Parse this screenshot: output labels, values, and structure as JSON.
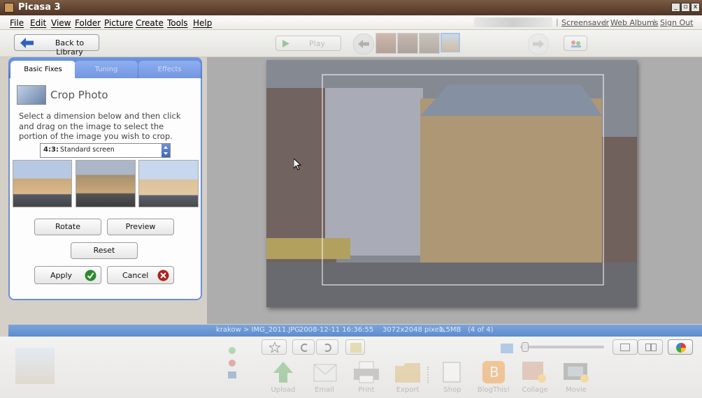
{
  "app": {
    "title": "Picasa 3"
  },
  "window_buttons": {
    "minimize": "_",
    "restore": "▫",
    "close": "x"
  },
  "menu": [
    "File",
    "Edit",
    "View",
    "Folder",
    "Picture",
    "Create",
    "Tools",
    "Help"
  ],
  "account_links": [
    "Screensaver",
    "Web Albums",
    "Sign Out"
  ],
  "toolbar": {
    "back_label": "Back to Library",
    "play_label": "Play"
  },
  "tabs": [
    "Basic Fixes",
    "Tuning",
    "Effects"
  ],
  "crop": {
    "title": "Crop Photo",
    "instructions": "Select a dimension below and then click and drag on the image to select the portion of the image you wish to crop.",
    "ratio_key": "4:3:",
    "ratio_name": "Standard screen"
  },
  "buttons": {
    "rotate": "Rotate",
    "preview": "Preview",
    "reset": "Reset",
    "apply": "Apply",
    "cancel": "Cancel"
  },
  "status": {
    "path": "krakow > IMG_2011.JPG",
    "date": "2008-12-11 16:36:55",
    "dims": "3072x2048 pixels",
    "size": "1,5MB",
    "position": "(4 of 4)"
  },
  "bottom_actions": [
    "Upload",
    "Email",
    "Print",
    "Export",
    "Shop",
    "BlogThis!",
    "Collage",
    "Movie"
  ],
  "colors": {
    "accent": "#5b84cf",
    "apply_check": "#2c8a2c",
    "cancel_x": "#b02020"
  }
}
